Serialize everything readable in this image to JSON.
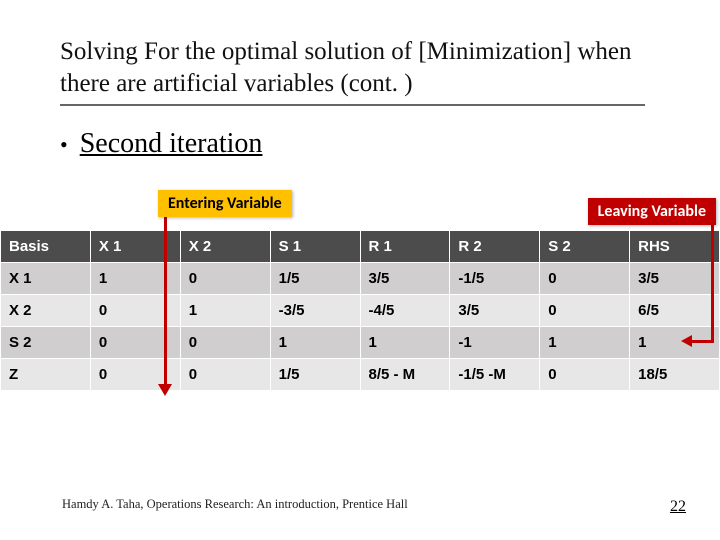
{
  "title": "Solving For the optimal solution of [Minimization] when there are artificial variables (cont. )",
  "bullet": "Second iteration",
  "entering_label": "Entering Variable",
  "leaving_label": "Leaving Variable",
  "table": {
    "headers": [
      "Basis",
      "X 1",
      "X 2",
      "S 1",
      "R 1",
      "R 2",
      "S 2",
      "RHS"
    ],
    "rows": [
      [
        "X 1",
        "1",
        "0",
        "1/5",
        "3/5",
        "-1/5",
        "0",
        "3/5"
      ],
      [
        "X 2",
        "0",
        "1",
        "-3/5",
        "-4/5",
        "3/5",
        "0",
        "6/5"
      ],
      [
        "S 2",
        "0",
        "0",
        "1",
        "1",
        "-1",
        "1",
        "1"
      ],
      [
        "Z",
        "0",
        "0",
        "1/5",
        "8/5 - M",
        "-1/5 -M",
        "0",
        "18/5"
      ]
    ]
  },
  "footer": "Hamdy A. Taha, Operations Research: An introduction, Prentice Hall",
  "page_number": "22",
  "chart_data": {
    "type": "table",
    "title": "Second iteration simplex tableau",
    "columns": [
      "Basis",
      "X1",
      "X2",
      "S1",
      "R1",
      "R2",
      "S2",
      "RHS"
    ],
    "rows": [
      {
        "Basis": "X1",
        "X1": "1",
        "X2": "0",
        "S1": "1/5",
        "R1": "3/5",
        "R2": "-1/5",
        "S2": "0",
        "RHS": "3/5"
      },
      {
        "Basis": "X2",
        "X1": "0",
        "X2": "1",
        "S1": "-3/5",
        "R1": "-4/5",
        "R2": "3/5",
        "S2": "0",
        "RHS": "6/5"
      },
      {
        "Basis": "S2",
        "X1": "0",
        "X2": "0",
        "S1": "1",
        "R1": "1",
        "R2": "-1",
        "S2": "1",
        "RHS": "1"
      },
      {
        "Basis": "Z",
        "X1": "0",
        "X2": "0",
        "S1": "1/5",
        "R1": "8/5 - M",
        "R2": "-1/5 - M",
        "S2": "0",
        "RHS": "18/5"
      }
    ],
    "entering_variable_column": "X1",
    "leaving_variable_row": "S2"
  }
}
